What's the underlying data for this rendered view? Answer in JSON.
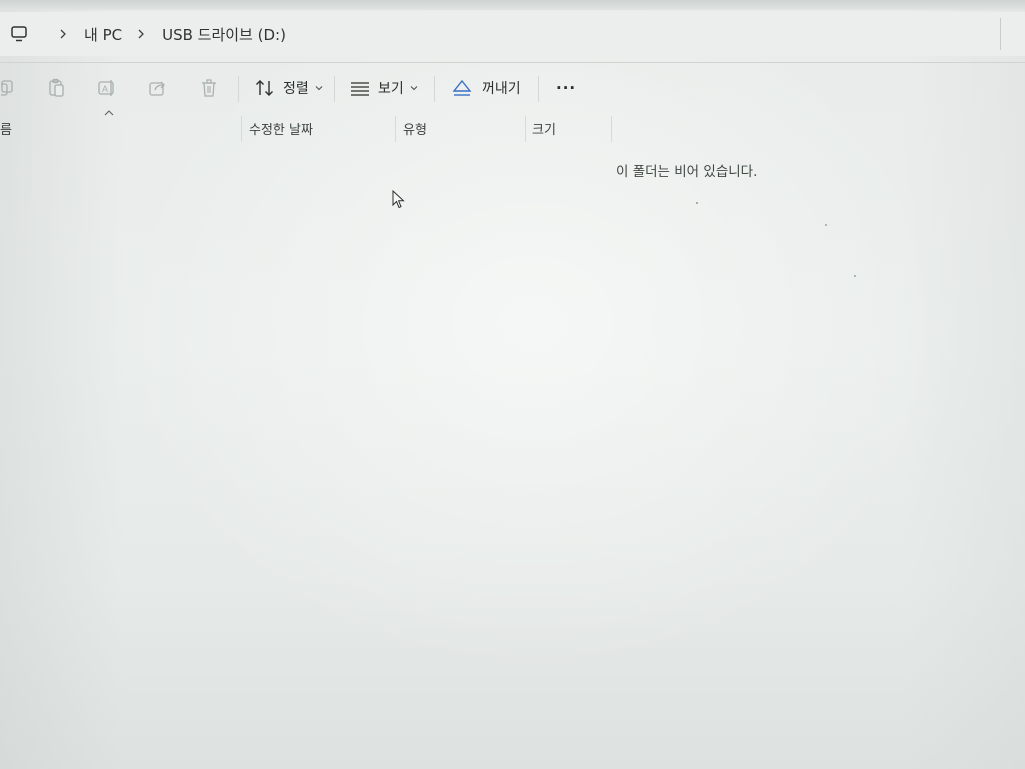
{
  "breadcrumb": {
    "items": [
      {
        "label": "내 PC"
      },
      {
        "label": "USB 드라이브 (D:)"
      }
    ]
  },
  "toolbar": {
    "sort_label": "정렬",
    "view_label": "보기",
    "eject_label": "꺼내기",
    "more_label": "···"
  },
  "columns": {
    "name": "름",
    "date_modified": "수정한 날짜",
    "type": "유형",
    "size": "크기"
  },
  "content": {
    "empty_message": "이 폴더는 비어 있습니다."
  },
  "colors": {
    "background": "#e9ecea",
    "text": "#2b3330",
    "accent": "#3a6fc4"
  },
  "icons": [
    "computer-icon",
    "chevron-right-icon",
    "copy-icon",
    "paste-icon",
    "rename-icon",
    "share-icon",
    "delete-icon",
    "sort-icon",
    "view-icon",
    "eject-icon",
    "more-icon",
    "cursor-icon"
  ]
}
